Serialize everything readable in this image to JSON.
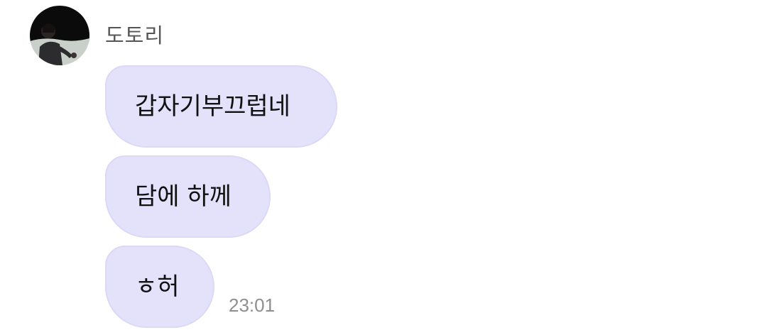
{
  "sender": {
    "name": "도토리",
    "avatar_icon": "profile-photo"
  },
  "messages": [
    {
      "text": "갑자기부끄럽네"
    },
    {
      "text": "담에 하께"
    },
    {
      "text": "ㅎ허"
    }
  ],
  "timestamp": "23:01",
  "colors": {
    "bubble": "#e4e1fb",
    "bubble_border": "#dcd8f6",
    "name_text": "#555555",
    "timestamp_text": "#8e8e8e"
  }
}
